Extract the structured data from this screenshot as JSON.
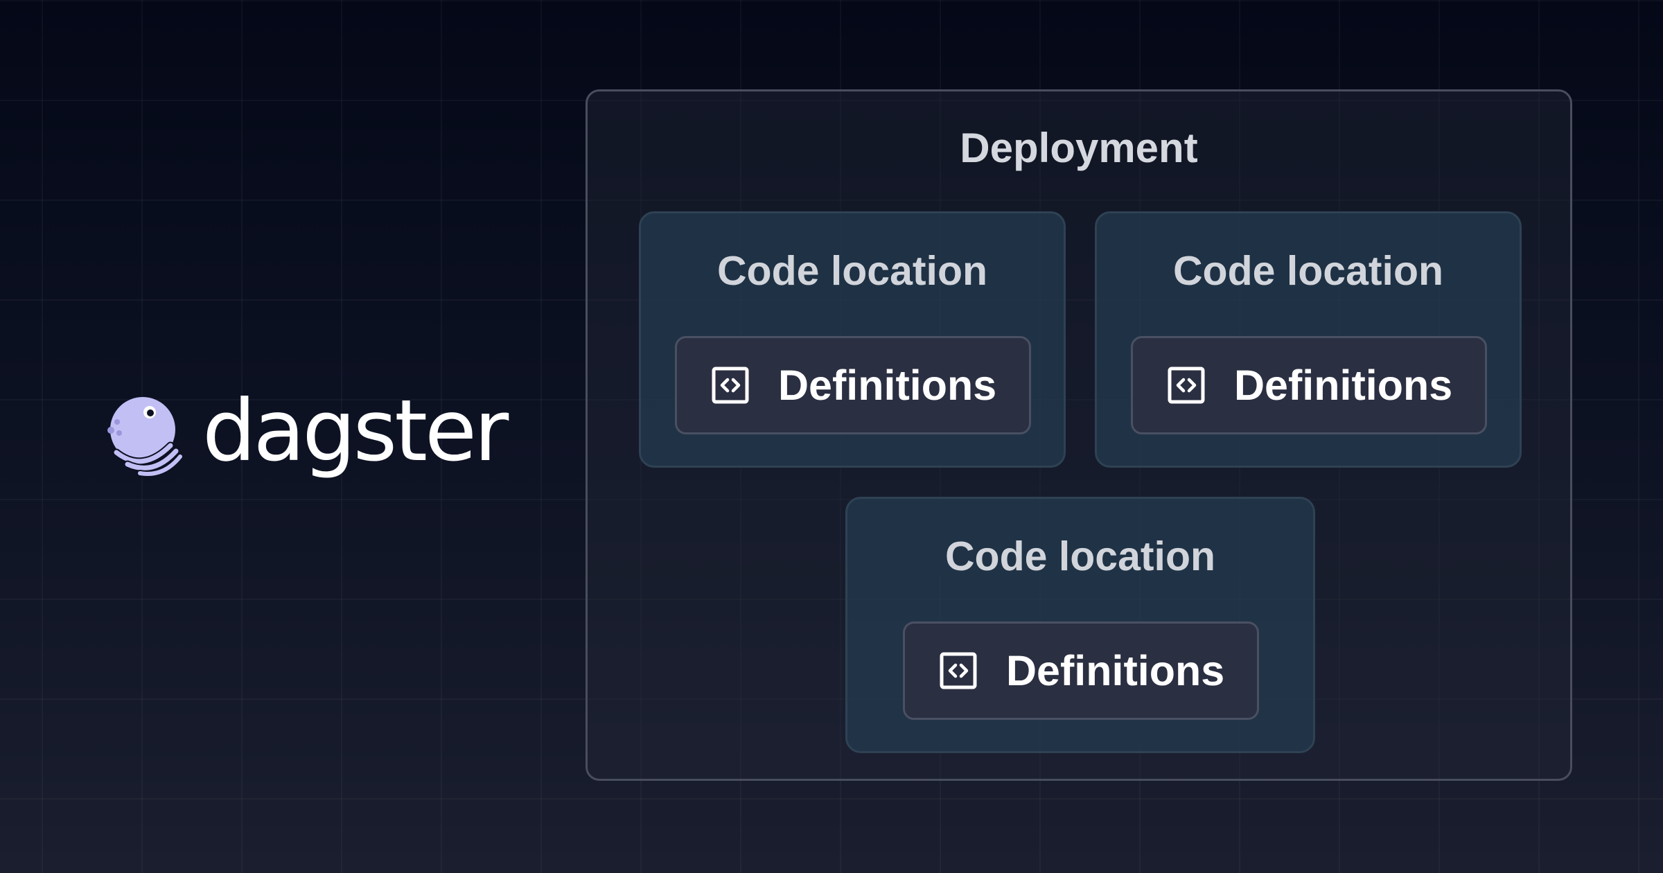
{
  "logo": {
    "name": "dagster"
  },
  "deployment": {
    "title": "Deployment",
    "code_locations": [
      {
        "title": "Code location",
        "definitions_label": "Definitions"
      },
      {
        "title": "Code location",
        "definitions_label": "Definitions"
      },
      {
        "title": "Code location",
        "definitions_label": "Definitions"
      }
    ]
  },
  "icons": {
    "logo": "dagster-octopus-logo-icon",
    "definitions": "code-brackets-icon"
  },
  "colors": {
    "background_top": "#040817",
    "background_bottom": "#1a1e2e",
    "logo_lavender": "#c2bff5",
    "code_location_fill": "#243c50",
    "definitions_fill": "#2b2f42",
    "text_white": "#ffffff",
    "text_light": "#d5d8de"
  }
}
